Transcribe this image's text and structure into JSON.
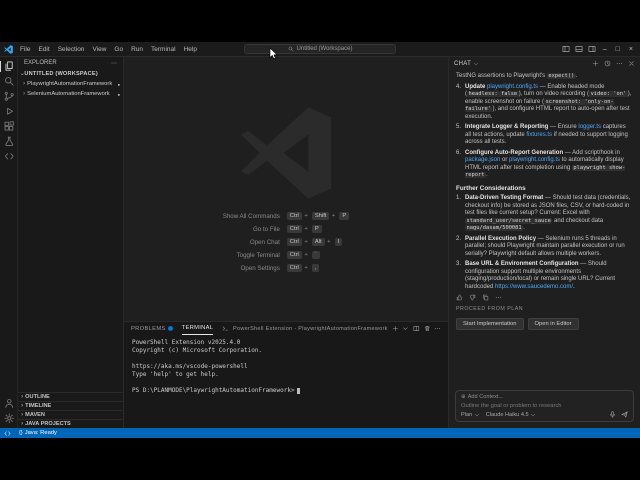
{
  "glyphs": {
    "chevron": "›",
    "more": "⋯",
    "dot": "●",
    "circle_plus": "⊕",
    "braces": "{}",
    "minimize": "–",
    "maximize": "□",
    "close": "×"
  },
  "title_bar": {
    "menus": [
      "File",
      "Edit",
      "Selection",
      "View",
      "Go",
      "Run",
      "Terminal",
      "Help"
    ],
    "command_center": "Untitled (Workspace)"
  },
  "activity_bar": {
    "top": [
      {
        "name": "explorer",
        "icon": "#i-files",
        "active": true
      },
      {
        "name": "search",
        "icon": "#i-search"
      },
      {
        "name": "source-control",
        "icon": "#i-git"
      },
      {
        "name": "run-and-debug",
        "icon": "#i-debug"
      },
      {
        "name": "extensions",
        "icon": "#i-ext"
      },
      {
        "name": "testing",
        "icon": "#i-flask"
      },
      {
        "name": "remote-explorer",
        "icon": "#i-remote"
      }
    ],
    "bottom": [
      {
        "name": "accounts",
        "icon": "#i-person"
      },
      {
        "name": "settings",
        "icon": "#i-gear"
      }
    ]
  },
  "sidebar": {
    "title": "EXPLORER",
    "workspace": "UNTITLED (WORKSPACE)",
    "tree": [
      {
        "label": "PlaywrightAutomationFramework",
        "modified": true
      },
      {
        "label": "SeleniumAutomationFramework",
        "modified": true
      }
    ],
    "sections": [
      {
        "label": "OUTLINE"
      },
      {
        "label": "TIMELINE"
      },
      {
        "label": "MAVEN"
      },
      {
        "label": "JAVA PROJECTS"
      }
    ]
  },
  "editor": {
    "shortcuts": [
      {
        "label": "Show All Commands",
        "keys": [
          "Ctrl",
          "Shift",
          "P"
        ]
      },
      {
        "label": "Go to File",
        "keys": [
          "Ctrl",
          "P"
        ]
      },
      {
        "label": "Open Chat",
        "keys": [
          "Ctrl",
          "Alt",
          "I"
        ]
      },
      {
        "label": "Toggle Terminal",
        "keys": [
          "Ctrl",
          "`"
        ]
      },
      {
        "label": "Open Settings",
        "keys": [
          "Ctrl",
          ","
        ]
      }
    ]
  },
  "panel": {
    "tabs": [
      "PROBLEMS",
      "TERMINAL"
    ],
    "shell_label": "PowerShell Extension - PlaywrightAutomationFramework",
    "terminal_lines": [
      "PowerShell Extension v2025.4.0",
      "Copyright (c) Microsoft Corporation.",
      "",
      "https://aka.ms/vscode-powershell",
      "Type 'help' to get help.",
      ""
    ],
    "prompt": "PS D:\\PLANMODE\\PlaywrightAutomationFramework>"
  },
  "chat": {
    "title": "CHAT",
    "intro_segments": [
      {
        "t": "text",
        "v": "TestNG assertions to Playwright's "
      },
      {
        "t": "code",
        "v": "expect()"
      },
      {
        "t": "text",
        "v": "."
      }
    ],
    "steps": [
      {
        "num": "4.",
        "segments": [
          {
            "t": "bold",
            "v": "Update "
          },
          {
            "t": "link",
            "v": "playwright.config.ts"
          },
          {
            "t": "text",
            "v": " — Enable headed mode ("
          },
          {
            "t": "code",
            "v": "headless: false"
          },
          {
            "t": "text",
            "v": "), turn on video recording ("
          },
          {
            "t": "code",
            "v": "video: 'on'"
          },
          {
            "t": "text",
            "v": "), enable screenshot on failure ("
          },
          {
            "t": "code",
            "v": "screenshot: 'only-on-failure'"
          },
          {
            "t": "text",
            "v": "), and configure HTML report to auto-open after test execution."
          }
        ]
      },
      {
        "num": "5.",
        "segments": [
          {
            "t": "bold",
            "v": "Integrate Logger & Reporting"
          },
          {
            "t": "text",
            "v": " — Ensure "
          },
          {
            "t": "link",
            "v": "logger.ts"
          },
          {
            "t": "text",
            "v": " captures all test actions, update "
          },
          {
            "t": "link",
            "v": "fixtures.ts"
          },
          {
            "t": "text",
            "v": " if needed to support logging across all tests."
          }
        ]
      },
      {
        "num": "6.",
        "segments": [
          {
            "t": "bold",
            "v": "Configure Auto-Report Generation"
          },
          {
            "t": "text",
            "v": " — Add script/hook in "
          },
          {
            "t": "link",
            "v": "package.json"
          },
          {
            "t": "text",
            "v": " or "
          },
          {
            "t": "link",
            "v": "playwright.config.ts"
          },
          {
            "t": "text",
            "v": " to automatically display HTML report after test completion using "
          },
          {
            "t": "code",
            "v": "playwright show-report"
          },
          {
            "t": "text",
            "v": "."
          }
        ]
      }
    ],
    "heading": "Further Considerations",
    "considerations": [
      {
        "num": "1.",
        "segments": [
          {
            "t": "bold",
            "v": "Data-Driven Testing Format"
          },
          {
            "t": "text",
            "v": " — Should test data (credentials, checkout info) be stored as JSON files, CSV, or hard-coded in test files like current setup? Current: Excel with "
          },
          {
            "t": "code",
            "v": "standard_user/secret_sauce"
          },
          {
            "t": "text",
            "v": " and checkout data "
          },
          {
            "t": "code",
            "v": "nagu/dasam/500081"
          },
          {
            "t": "text",
            "v": "."
          }
        ]
      },
      {
        "num": "2.",
        "segments": [
          {
            "t": "bold",
            "v": "Parallel Execution Policy"
          },
          {
            "t": "text",
            "v": " — Selenium runs 5 threads in parallel; should Playwright maintain parallel execution or run serially? Playwright default allows multiple workers."
          }
        ]
      },
      {
        "num": "3.",
        "segments": [
          {
            "t": "bold",
            "v": "Base URL & Environment Configuration"
          },
          {
            "t": "text",
            "v": " — Should configuration support multiple environments (staging/production/local) or remain single URL? Current hardcoded "
          },
          {
            "t": "link",
            "v": "https://www.saucedemo.com/"
          },
          {
            "t": "text",
            "v": "."
          }
        ]
      }
    ],
    "proceed_label": "PROCEED FROM PLAN",
    "buttons": [
      "Start Implementation",
      "Open in Editor"
    ],
    "composer": {
      "add_context": "Add Context...",
      "placeholder": "Outline the goal or problem to research",
      "mode": "Plan",
      "model": "Claude Haiku 4.5"
    }
  },
  "status_bar": {
    "java_label": "Java: Ready"
  }
}
